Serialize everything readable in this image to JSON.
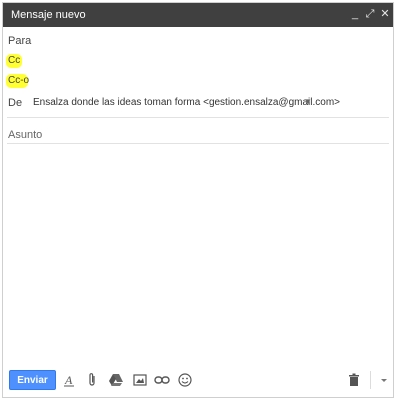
{
  "window": {
    "title": "Mensaje nuevo",
    "controls": {
      "minimize": "_",
      "expand": "⤢",
      "close": "✕"
    }
  },
  "fields": {
    "to_label": "Para",
    "cc_label": "Cc",
    "bcc_label": "Cc-o",
    "from_label": "De",
    "from_value": "Ensalza donde las ideas toman forma <gestion.ensalza@gmail.com>",
    "subject_placeholder": "Asunto"
  },
  "highlight_color": "#ffff33",
  "footer": {
    "send_label": "Enviar",
    "icons": [
      "formatting-icon",
      "attach-icon",
      "drive-icon",
      "photo-icon",
      "link-icon",
      "emoji-icon",
      "trash-icon",
      "more-options-icon"
    ]
  }
}
